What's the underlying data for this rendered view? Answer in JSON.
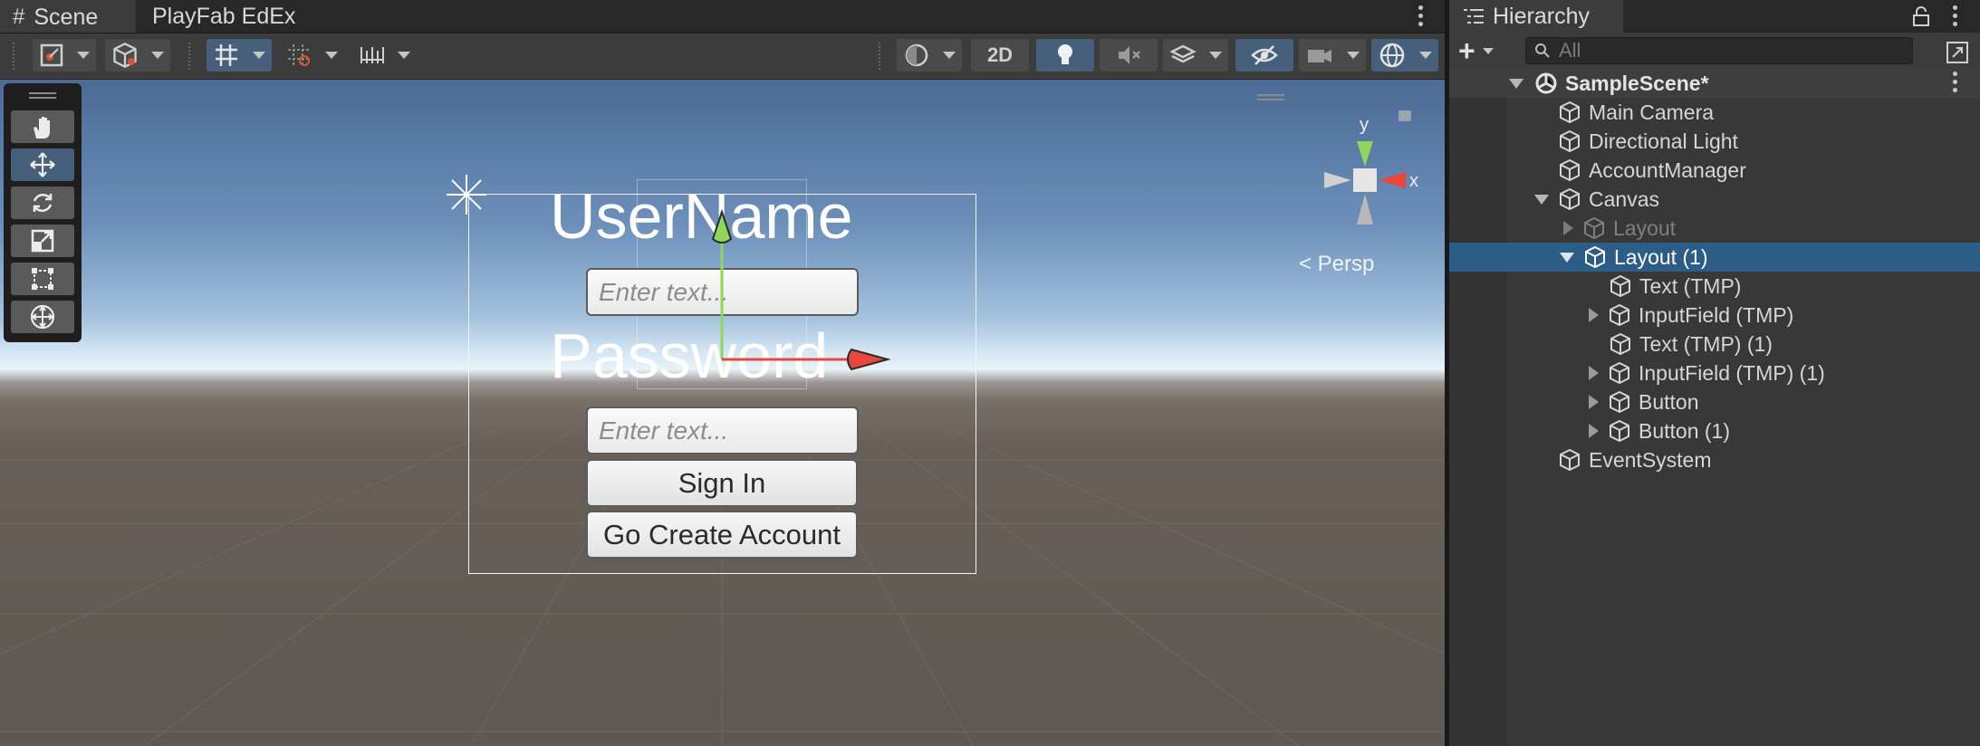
{
  "scene_tabs": {
    "scene": "Scene",
    "playfab": "PlayFab EdEx"
  },
  "toolbar": {
    "mode_2d": "2D"
  },
  "scene_view": {
    "username_label": "UserName",
    "password_label": "Password",
    "username_placeholder": "Enter text...",
    "password_placeholder": "Enter text...",
    "sign_in_button": "Sign In",
    "create_account_button": "Go Create Account",
    "gizmo_axis_y": "y",
    "gizmo_axis_x": "x",
    "projection": "< Persp"
  },
  "hierarchy": {
    "tab_label": "Hierarchy",
    "search_placeholder": "All",
    "scene_name": "SampleScene*",
    "items": [
      {
        "label": "Main Camera"
      },
      {
        "label": "Directional Light"
      },
      {
        "label": "AccountManager"
      },
      {
        "label": "Canvas"
      },
      {
        "label": "Layout"
      },
      {
        "label": "Layout (1)"
      },
      {
        "label": "Text (TMP)"
      },
      {
        "label": "InputField (TMP)"
      },
      {
        "label": "Text (TMP) (1)"
      },
      {
        "label": "InputField (TMP) (1)"
      },
      {
        "label": "Button"
      },
      {
        "label": "Button (1)"
      },
      {
        "label": "EventSystem"
      }
    ]
  },
  "colors": {
    "selection": "#2c5d87",
    "active_tool": "#46607c",
    "panel": "#383838"
  }
}
